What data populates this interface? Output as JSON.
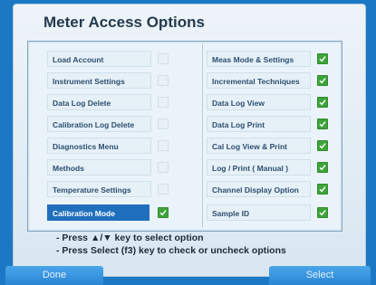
{
  "screen": {
    "title": "Meter Access Options"
  },
  "options": {
    "left": [
      {
        "label": "Load Account",
        "checked": false,
        "selected": false
      },
      {
        "label": "Instrument Settings",
        "checked": false,
        "selected": false
      },
      {
        "label": "Data Log Delete",
        "checked": false,
        "selected": false
      },
      {
        "label": "Calibration Log Delete",
        "checked": false,
        "selected": false
      },
      {
        "label": "Diagnostics Menu",
        "checked": false,
        "selected": false
      },
      {
        "label": "Methods",
        "checked": false,
        "selected": false
      },
      {
        "label": "Temperature Settings",
        "checked": false,
        "selected": false
      },
      {
        "label": "Calibration Mode",
        "checked": true,
        "selected": true
      }
    ],
    "right": [
      {
        "label": "Meas Mode & Settings",
        "checked": true,
        "selected": false
      },
      {
        "label": "Incremental Techniques",
        "checked": true,
        "selected": false
      },
      {
        "label": "Data Log View",
        "checked": true,
        "selected": false
      },
      {
        "label": "Data Log Print",
        "checked": true,
        "selected": false
      },
      {
        "label": "Cal Log View & Print",
        "checked": true,
        "selected": false
      },
      {
        "label": "Log / Print ( Manual )",
        "checked": true,
        "selected": false
      },
      {
        "label": "Channel Display Option",
        "checked": true,
        "selected": false
      },
      {
        "label": "Sample ID",
        "checked": true,
        "selected": false
      }
    ]
  },
  "instructions": {
    "line1": "- Press ▲/▼ key to select option",
    "line2": "- Press Select (f3) key to check or uncheck options"
  },
  "softkeys": {
    "f1": "Done",
    "f3": "Select"
  },
  "colors": {
    "background": "#1a78c4",
    "selected_row": "#1f6fbd",
    "checkbox_on": "#3fa33a",
    "title_text": "#243a4d"
  }
}
